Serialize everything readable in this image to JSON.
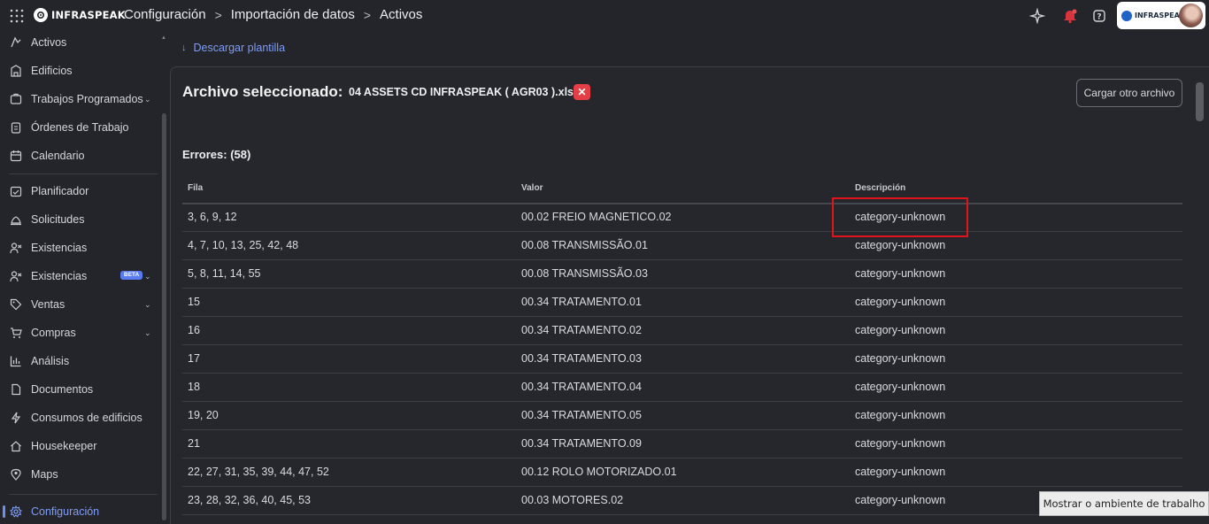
{
  "topbar": {
    "brand": "INFRASPEAK",
    "breadcrumb": [
      "Configuración",
      "Importación de datos",
      "Activos"
    ],
    "account_brand": "INFRASPEAK"
  },
  "sidebar": {
    "items": [
      {
        "label": "Activos",
        "icon": "asset-icon"
      },
      {
        "label": "Edificios",
        "icon": "building-icon"
      },
      {
        "label": "Trabajos Programados",
        "icon": "scheduled-work-icon",
        "has_chevron": true
      },
      {
        "label": "Órdenes de Trabajo",
        "icon": "clipboard-icon"
      },
      {
        "label": "Calendario",
        "icon": "calendar-icon"
      },
      {
        "label": "Planificador",
        "icon": "planner-icon"
      },
      {
        "label": "Solicitudes",
        "icon": "bell-icon"
      },
      {
        "label": "Existencias",
        "icon": "stock-icon"
      },
      {
        "label": "Existencias",
        "icon": "stock-icon",
        "badge": "BETA",
        "has_chevron": true
      },
      {
        "label": "Ventas",
        "icon": "tag-icon",
        "has_chevron": true
      },
      {
        "label": "Compras",
        "icon": "cart-icon",
        "has_chevron": true
      },
      {
        "label": "Análisis",
        "icon": "chart-icon"
      },
      {
        "label": "Documentos",
        "icon": "document-icon"
      },
      {
        "label": "Consumos de edificios",
        "icon": "lightning-icon"
      },
      {
        "label": "Housekeeper",
        "icon": "house-icon"
      },
      {
        "label": "Maps",
        "icon": "map-pin-icon"
      },
      {
        "label": "Configuración",
        "icon": "gear-icon",
        "active": true
      }
    ]
  },
  "main": {
    "download_label": "Descargar plantilla",
    "file_title": "Archivo seleccionado:",
    "file_name": "04 ASSETS CD INFRASPEAK ( AGR03 ).xlsx",
    "remove_label": "✕",
    "upload_button": "Cargar otro archivo",
    "errors_title": "Errores: (58)",
    "table": {
      "headers": [
        "Fila",
        "Valor",
        "Descripción"
      ],
      "rows": [
        {
          "fila": "3, 6, 9, 12",
          "valor": "00.02 FREIO MAGNETICO.02",
          "descripcion": "category-unknown"
        },
        {
          "fila": "4, 7, 10, 13, 25, 42, 48",
          "valor": "00.08 TRANSMISSÃO.01",
          "descripcion": "category-unknown"
        },
        {
          "fila": "5, 8, 11, 14, 55",
          "valor": "00.08 TRANSMISSÃO.03",
          "descripcion": "category-unknown"
        },
        {
          "fila": "15",
          "valor": "00.34 TRATAMENTO.01",
          "descripcion": "category-unknown"
        },
        {
          "fila": "16",
          "valor": "00.34 TRATAMENTO.02",
          "descripcion": "category-unknown"
        },
        {
          "fila": "17",
          "valor": "00.34 TRATAMENTO.03",
          "descripcion": "category-unknown"
        },
        {
          "fila": "18",
          "valor": "00.34 TRATAMENTO.04",
          "descripcion": "category-unknown"
        },
        {
          "fila": "19, 20",
          "valor": "00.34 TRATAMENTO.05",
          "descripcion": "category-unknown"
        },
        {
          "fila": "21",
          "valor": "00.34 TRATAMENTO.09",
          "descripcion": "category-unknown"
        },
        {
          "fila": "22, 27, 31, 35, 39, 44, 47, 52",
          "valor": "00.12 ROLO MOTORIZADO.01",
          "descripcion": "category-unknown"
        },
        {
          "fila": "23, 28, 32, 36, 40, 45, 53",
          "valor": "00.03 MOTORES.02",
          "descripcion": "category-unknown"
        }
      ]
    }
  },
  "tooltip": "Mostrar o ambiente de trabalho",
  "colors": {
    "background": "#24252a",
    "accent": "#7e9cf4",
    "danger": "#e53e46",
    "highlight_box": "#e0141b"
  }
}
